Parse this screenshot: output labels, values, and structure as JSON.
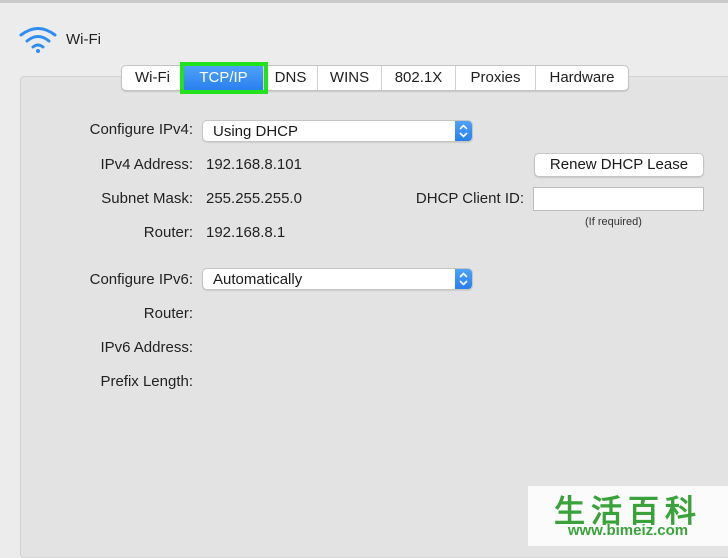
{
  "header": {
    "title": "Wi-Fi"
  },
  "tabs": [
    {
      "label": "Wi-Fi"
    },
    {
      "label": "TCP/IP"
    },
    {
      "label": "DNS"
    },
    {
      "label": "WINS"
    },
    {
      "label": "802.1X"
    },
    {
      "label": "Proxies"
    },
    {
      "label": "Hardware"
    }
  ],
  "active_tab": "TCP/IP",
  "ipv4": {
    "configure_label": "Configure IPv4:",
    "configure_value": "Using DHCP",
    "address_label": "IPv4 Address:",
    "address_value": "192.168.8.101",
    "subnet_label": "Subnet Mask:",
    "subnet_value": "255.255.255.0",
    "router_label": "Router:",
    "router_value": "192.168.8.1",
    "renew_button": "Renew DHCP Lease",
    "client_id_label": "DHCP Client ID:",
    "client_id_value": "",
    "client_id_hint": "(If required)"
  },
  "ipv6": {
    "configure_label": "Configure IPv6:",
    "configure_value": "Automatically",
    "router_label": "Router:",
    "address_label": "IPv6 Address:",
    "prefix_label": "Prefix Length:"
  },
  "watermark": {
    "chinese": "生活百科",
    "url": "www.bimeiz.com"
  },
  "colors": {
    "accent": "#2a7ff0",
    "highlight": "#22e21e",
    "watermark": "#3aa23a"
  }
}
